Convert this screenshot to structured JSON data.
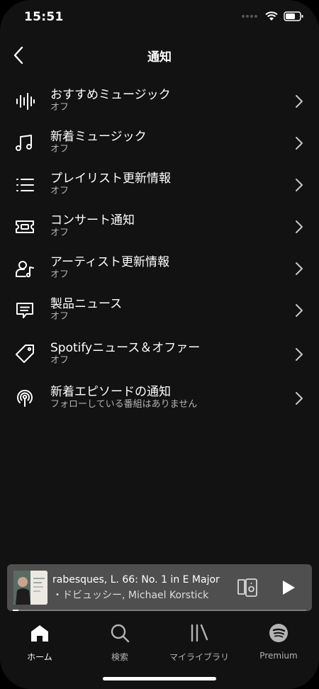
{
  "status": {
    "time": "15:51"
  },
  "header": {
    "title": "通知"
  },
  "settings": [
    {
      "label": "おすすめミュージック",
      "sub": "オフ",
      "icon": "waveform-icon"
    },
    {
      "label": "新着ミュージック",
      "sub": "オフ",
      "icon": "music-note-icon"
    },
    {
      "label": "プレイリスト更新情報",
      "sub": "オフ",
      "icon": "list-icon"
    },
    {
      "label": "コンサート通知",
      "sub": "オフ",
      "icon": "ticket-icon"
    },
    {
      "label": "アーティスト更新情報",
      "sub": "オフ",
      "icon": "artist-icon"
    },
    {
      "label": "製品ニュース",
      "sub": "オフ",
      "icon": "message-icon"
    },
    {
      "label": "Spotifyニュース＆オファー",
      "sub": "オフ",
      "icon": "tag-icon"
    },
    {
      "label": "新着エピソードの通知",
      "sub": "フォローしている番組はありません",
      "icon": "podcast-icon"
    }
  ],
  "player": {
    "title": "rabesques, L. 66: No. 1 in E Major",
    "artist": "・ドビュッシー, Michael Korstick",
    "progress": 0.02
  },
  "tabs": [
    {
      "label": "ホーム",
      "icon": "home-icon",
      "active": true
    },
    {
      "label": "検索",
      "icon": "search-icon",
      "active": false
    },
    {
      "label": "マイライブラリ",
      "icon": "library-icon",
      "active": false
    },
    {
      "label": "Premium",
      "icon": "spotify-icon",
      "active": false
    }
  ],
  "colors": {
    "background": "#121212",
    "mini_player": "#4f4f4f",
    "subtext": "#b3b3b3"
  }
}
